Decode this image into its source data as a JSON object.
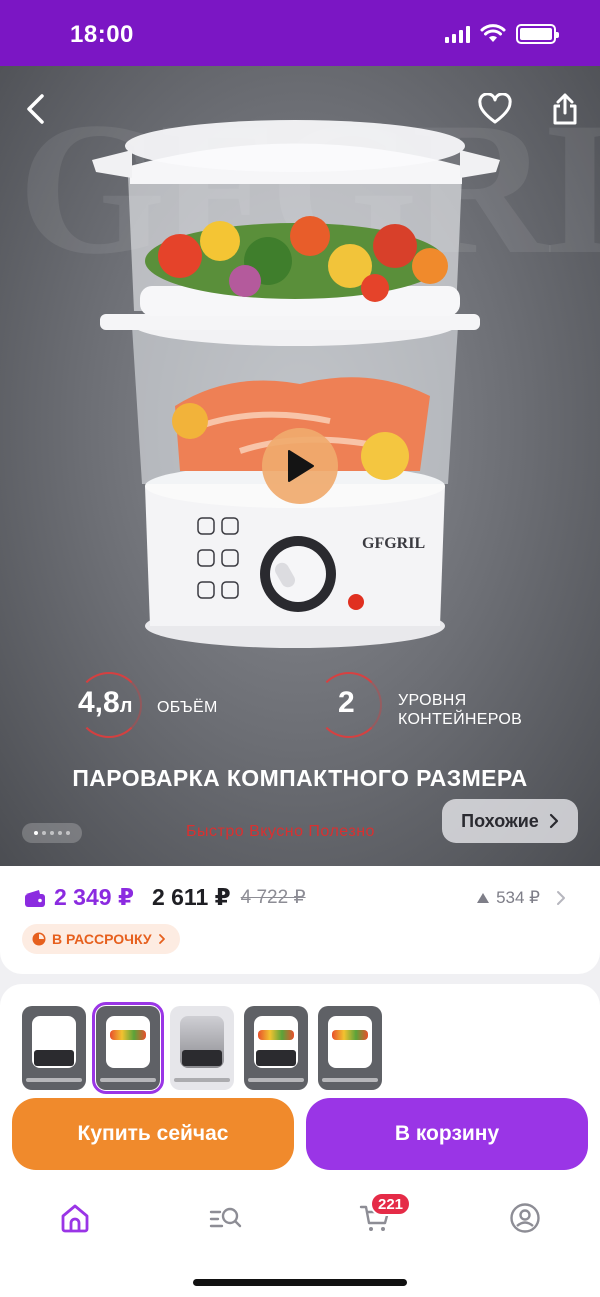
{
  "status_bar": {
    "time": "18:00"
  },
  "colors": {
    "brand": "#7b16c4",
    "accent_purple": "#9a35e6",
    "accent_orange": "#f08a2c",
    "badge_red": "#e52b47"
  },
  "hero": {
    "brand_watermark": "GFGRIL",
    "specs": [
      {
        "value": "4,8",
        "unit": "л",
        "label": "ОБЪЁМ"
      },
      {
        "value": "2",
        "unit": "",
        "label": "УРОВНЯ КОНТЕЙНЕРОВ"
      }
    ],
    "title": "ПАРОВАРКА КОМПАКТНОГО РАЗМЕРА",
    "tagline": "Быстро Вкусно Полезно",
    "similar_label": "Похожие",
    "pager": {
      "count": 5,
      "active": 1
    },
    "icons": {
      "back": "chevron-left-icon",
      "favorite": "heart-icon",
      "share": "share-icon",
      "play": "play-icon"
    }
  },
  "price": {
    "wallet_price": "2 349 ₽",
    "price": "2 611 ₽",
    "old_price": "4 722 ₽",
    "delta": "534 ₽",
    "installment_label": "В РАССРОЧКУ"
  },
  "gallery": {
    "thumbnails": [
      "thumb-1",
      "thumb-2",
      "thumb-3",
      "thumb-4",
      "thumb-5"
    ],
    "selected": 2
  },
  "actions": {
    "buy_now": "Купить сейчас",
    "add_to_cart": "В корзину"
  },
  "tabbar": {
    "items": [
      "home",
      "catalog-search",
      "cart",
      "profile"
    ],
    "cart_badge": "221"
  }
}
